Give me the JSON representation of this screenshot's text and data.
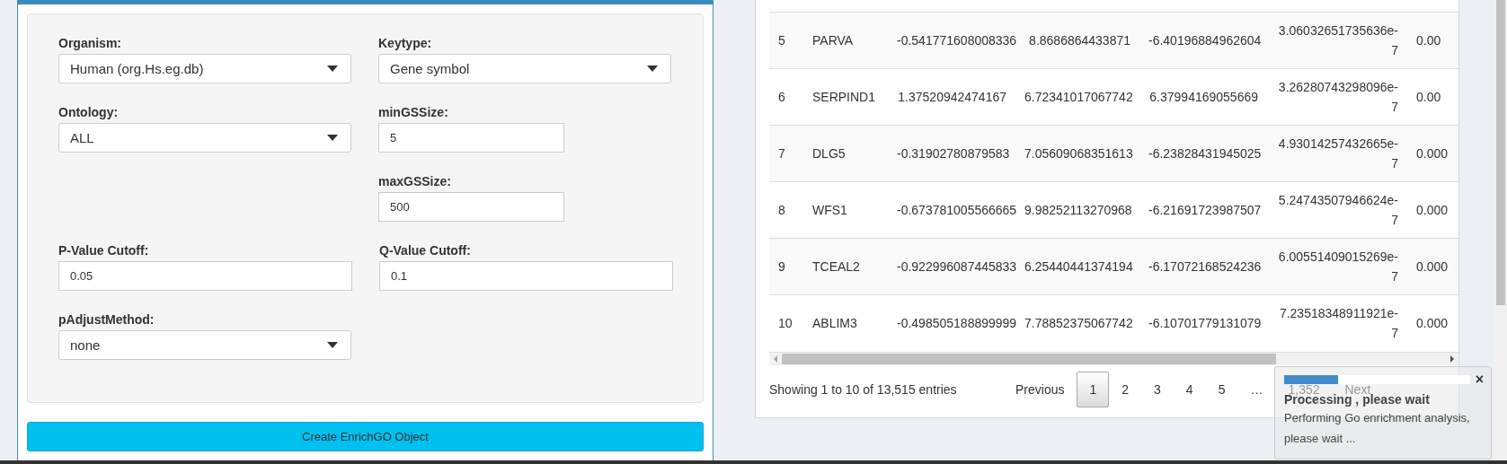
{
  "form": {
    "rows": [
      {
        "left": {
          "label": "Organism:",
          "kind": "select",
          "value": "Human (org.Hs.eg.db)"
        },
        "right": {
          "label": "Keytype:",
          "kind": "select",
          "value": "Gene symbol"
        }
      },
      {
        "left": {
          "label": "Ontology:",
          "kind": "select",
          "value": "ALL"
        },
        "right": {
          "label": "minGSSize:",
          "kind": "input",
          "value": "5"
        }
      },
      {
        "right": {
          "label": "maxGSSize:",
          "kind": "input",
          "value": "500"
        }
      },
      {
        "left": {
          "label": "P-Value Cutoff:",
          "kind": "input",
          "value": "0.05"
        },
        "right": {
          "label": "Q-Value Cutoff:",
          "kind": "input",
          "value": "0.1"
        }
      },
      {
        "left": {
          "label": "pAdjustMethod:",
          "kind": "select",
          "value": "none"
        }
      }
    ],
    "button": "Create EnrichGO Object"
  },
  "table": {
    "rows": [
      [
        "5",
        "PARVA",
        "-0.541771608008336",
        "8.8686864433871",
        "-6.40196884962604",
        "3.06032651735636e-7",
        "0.00"
      ],
      [
        "6",
        "SERPIND1",
        "1.37520942474167",
        "6.72341017067742",
        "6.37994169055669",
        "3.26280743298096e-7",
        "0.00"
      ],
      [
        "7",
        "DLG5",
        "-0.31902780879583",
        "7.05609068351613",
        "-6.23828431945025",
        "4.93014257432665e-7",
        "0.000"
      ],
      [
        "8",
        "WFS1",
        "-0.673781005566665",
        "9.98252113270968",
        "-6.21691723987507",
        "5.24743507946624e-7",
        "0.000"
      ],
      [
        "9",
        "TCEAL2",
        "-0.922996087445833",
        "6.25440441374194",
        "-6.17072168524236",
        "6.00551409015269e-7",
        "0.000"
      ],
      [
        "10",
        "ABLIM3",
        "-0.498505188899999",
        "7.78852375067742",
        "-6.10701779131079",
        "7.23518348911921e-7",
        "0.000"
      ]
    ],
    "info": "Showing 1 to 10 of 13,515 entries",
    "pagination": [
      {
        "label": "Previous",
        "selected": false
      },
      {
        "label": "1",
        "selected": true
      },
      {
        "label": "2",
        "selected": false
      },
      {
        "label": "3",
        "selected": false
      },
      {
        "label": "4",
        "selected": false
      },
      {
        "label": "5",
        "selected": false
      },
      {
        "label": "…",
        "selected": false
      },
      {
        "label": "1,352",
        "selected": false
      },
      {
        "label": "Next",
        "selected": false
      }
    ]
  },
  "notification": {
    "level": 0.29,
    "close": "×",
    "title": "Processing , please wait",
    "message": "Performing Go enrichment analysis, please wait ..."
  }
}
